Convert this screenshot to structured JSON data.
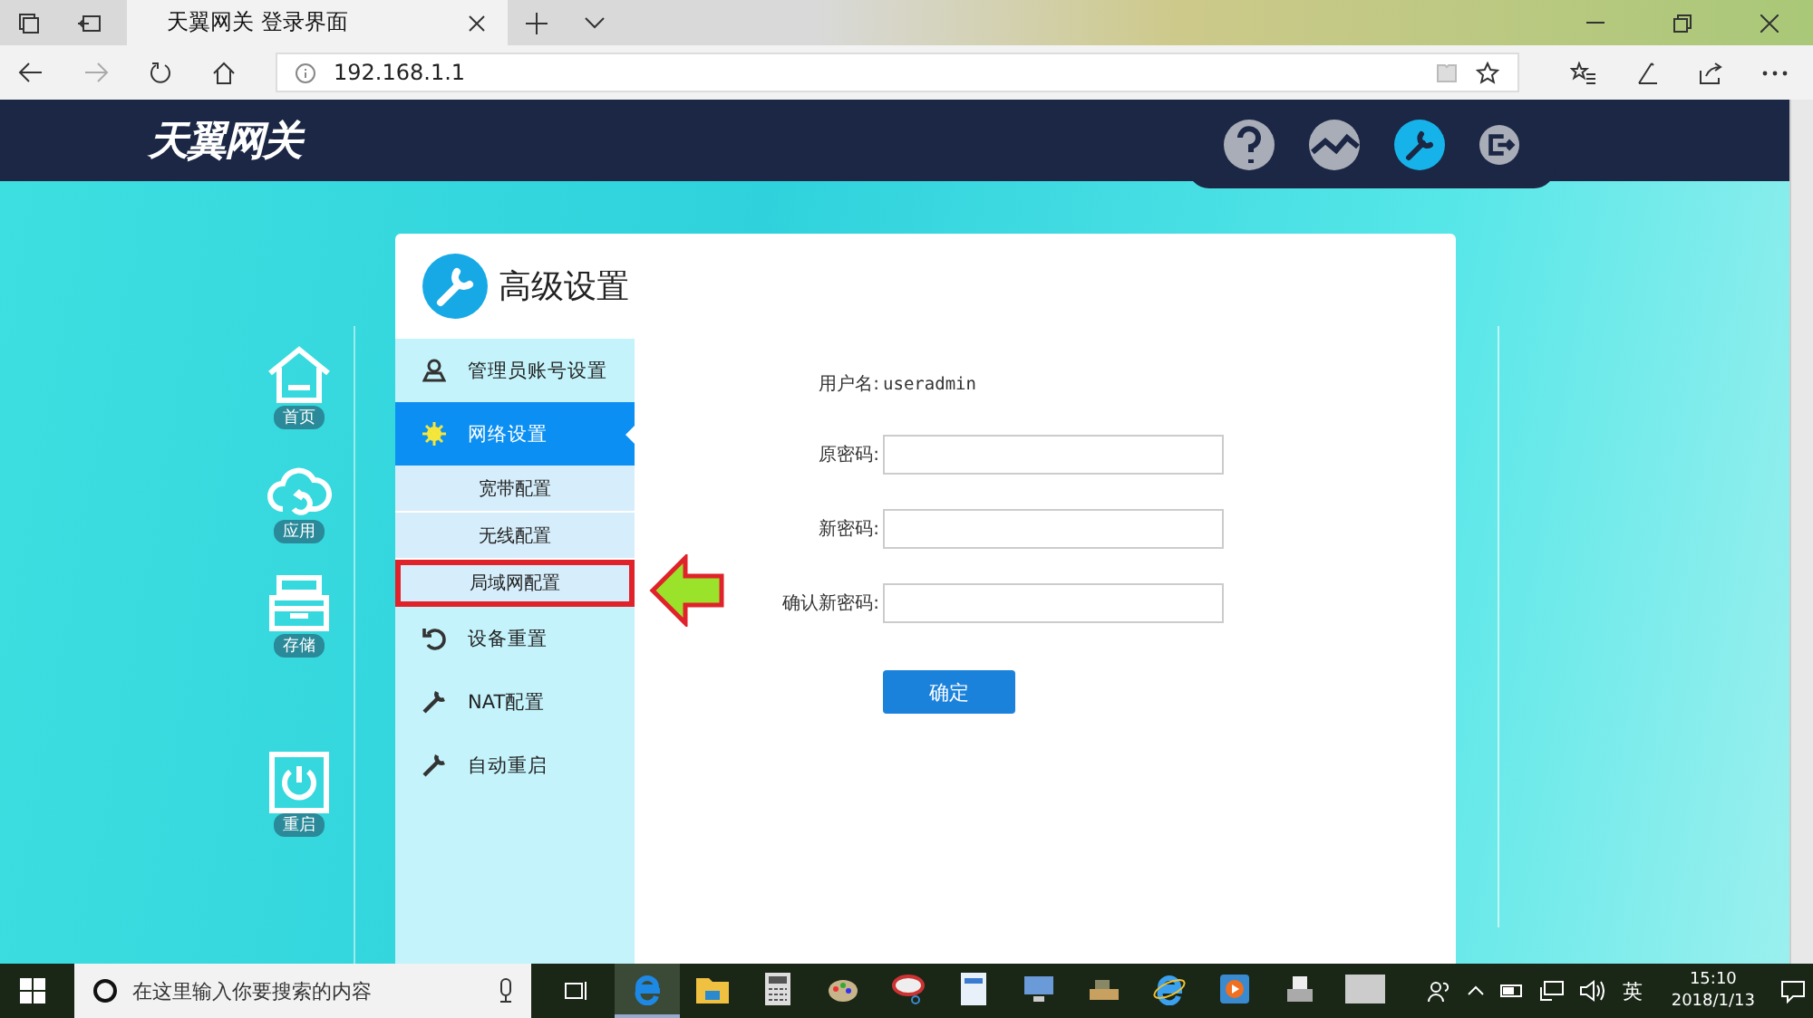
{
  "browser": {
    "tabs": [
      {
        "title": "天翼网关 登录界面",
        "selected": true
      }
    ],
    "url": "192.168.1.1"
  },
  "header": {
    "logo": "天翼网关",
    "nav": [
      {
        "kind": "help",
        "selected": false
      },
      {
        "kind": "chart",
        "selected": false
      },
      {
        "kind": "settings",
        "selected": true
      },
      {
        "kind": "logout",
        "selected": false
      }
    ]
  },
  "left_nav": [
    {
      "kind": "home",
      "label": "首页"
    },
    {
      "kind": "cloud",
      "label": "应用"
    },
    {
      "kind": "storage",
      "label": "存储"
    },
    {
      "kind": "power",
      "label": "重启"
    }
  ],
  "panel": {
    "title": "高级设置",
    "menu": [
      {
        "kind": "user",
        "label": "管理员账号设置",
        "selected": false
      },
      {
        "kind": "gear",
        "label": "网络设置",
        "selected": true,
        "children": [
          {
            "label": "宽带配置",
            "highlighted": false
          },
          {
            "label": "无线配置",
            "highlighted": false
          },
          {
            "label": "局域网配置",
            "highlighted": true
          }
        ]
      },
      {
        "kind": "reset",
        "label": "设备重置",
        "selected": false
      },
      {
        "kind": "wrench",
        "label": "NAT配置",
        "selected": false
      },
      {
        "kind": "wrench",
        "label": "自动重启",
        "selected": false
      }
    ],
    "form": {
      "username_label": "用户名:",
      "username": "useradmin",
      "fields": [
        {
          "label": "原密码:"
        },
        {
          "label": "新密码:"
        },
        {
          "label": "确认新密码:"
        }
      ],
      "submit": "确定"
    }
  },
  "taskbar": {
    "search_placeholder": "在这里输入你要搜索的内容",
    "ime": "英",
    "time": "15:10",
    "date": "2018/1/13"
  }
}
